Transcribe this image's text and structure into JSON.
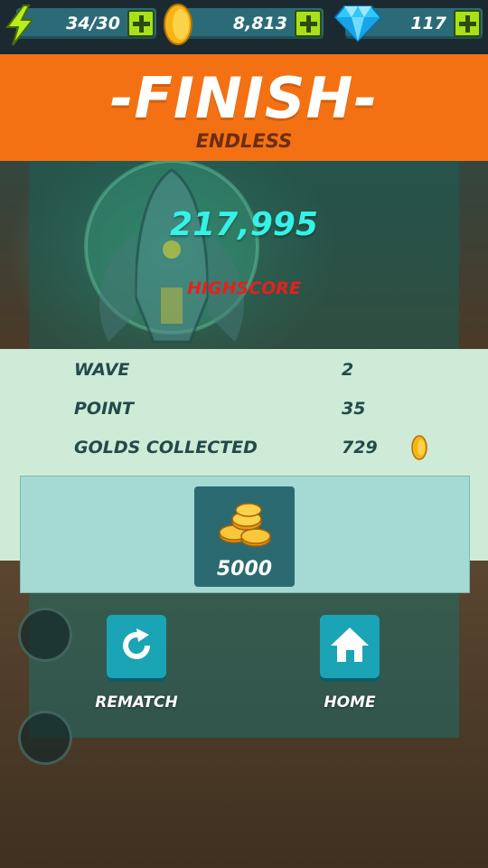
{
  "topbar": {
    "energy": {
      "value": "34/30",
      "icon": "lightning-icon"
    },
    "gold": {
      "value": "8,813",
      "icon": "gold-coin-icon"
    },
    "gems": {
      "value": "117",
      "icon": "diamond-icon"
    }
  },
  "banner": {
    "title": "-FINISH-",
    "mode": "ENDLESS"
  },
  "result": {
    "score": "217,995",
    "highscore_label": "HIGHSCORE"
  },
  "stats": [
    {
      "label": "WAVE",
      "value": "2"
    },
    {
      "label": "POINT",
      "value": "35"
    },
    {
      "label": "GOLDS COLLECTED",
      "value": "729"
    }
  ],
  "reward": {
    "amount": "5000",
    "icon": "coin-stack-icon"
  },
  "actions": {
    "rematch": "REMATCH",
    "home": "HOME"
  },
  "colors": {
    "banner": "#f47113",
    "score": "#35f2e6",
    "highscore": "#e8201c",
    "button": "#1aa4b5",
    "plus": "#a8e11a"
  }
}
